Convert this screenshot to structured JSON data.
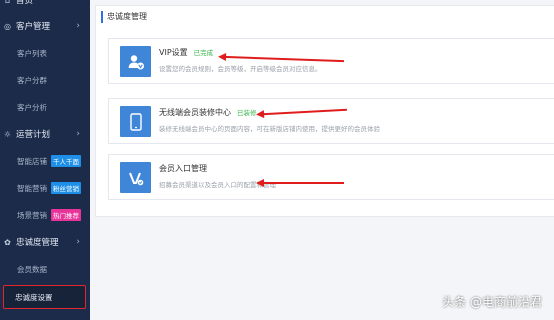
{
  "sidebar": {
    "top_label": "首页",
    "sections": [
      {
        "label": "客户管理",
        "items": [
          "客户列表",
          "客户分群",
          "客户分析"
        ]
      },
      {
        "label": "运营计划",
        "items": [
          {
            "label": "智能店铺",
            "badge": "千人千面"
          },
          {
            "label": "智能营销",
            "badge": "粉丝营销"
          },
          {
            "label": "场景营销",
            "badge": "热门推荐"
          }
        ]
      },
      {
        "label": "忠诚度管理",
        "items": [
          "会员数据",
          "忠诚度设置"
        ]
      }
    ]
  },
  "main": {
    "panel_title": "忠诚度管理",
    "cards": [
      {
        "title": "VIP设置",
        "status": "已完成",
        "desc": "设置您的会员规则，会员等级，开启等级会员对应信息。"
      },
      {
        "title": "无线端会员装修中心",
        "status": "已装修",
        "desc": "装修无线端会员中心的页面内容，可在新版店铺内使用，提供更好的会员体验"
      },
      {
        "title": "会员入口管理",
        "status": "",
        "desc": "招募会员渠道以及会员入口的配置和管理"
      }
    ]
  },
  "watermark": "头条 @电商前沿君",
  "colors": {
    "sidebar_bg": "#1c2b4a",
    "icon_bg": "#3f86d8",
    "status_green": "#39b54a",
    "annotation_red": "#e01d1d"
  }
}
